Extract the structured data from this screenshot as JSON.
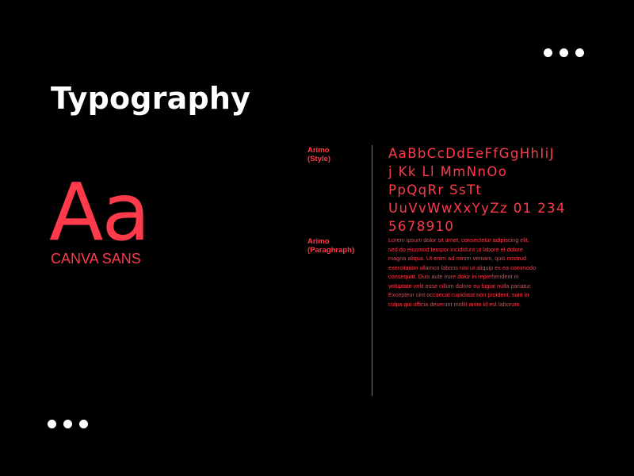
{
  "title": "Typography",
  "specimen": "Aa",
  "font_name": "CANVA SANS",
  "labels": {
    "style_line1": "Arimo",
    "style_line2": "(Style)",
    "paragraph_line1": "Arimo",
    "paragraph_line2": "(Paraghraph)"
  },
  "alphabet_lines": [
    "AaBbCcDdEeFfGgHhIiJ",
    "j Kk Ll MmNnOo",
    "PpQqRr SsTt",
    "UuVvWwXxYyZz 01 234",
    "5678910"
  ],
  "paragraph_lines": [
    "Lorem ipsum dolor sit amet, consectetur adipiscing elit,",
    "sed do eiusmod tempor incididunt ut labore et dolore",
    "magna aliqua. Ut enim ad minim veniam, quis nostrud",
    "exercitation ullamco laboris nisi ut aliquip ex ea commodo",
    "consequat. Duis aute irure dolor in reprehenderit in",
    "voluptate velit esse cillum dolore eu fugiat nulla pariatur.",
    "Excepteur sint occaecat cupidatat non proident, sunt in",
    "culpa qui officia deserunt mollit anim id est laborum."
  ],
  "colors": {
    "background": "#000000",
    "accent": "#ff3a4a",
    "title": "#ffffff"
  }
}
